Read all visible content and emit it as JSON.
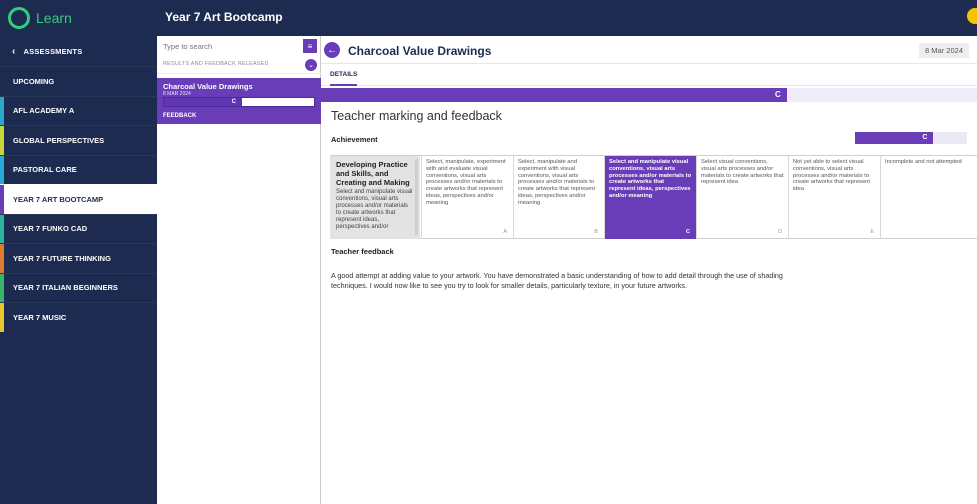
{
  "app": {
    "logo_text": "Learn",
    "title": "Year 7 Art Bootcamp"
  },
  "nav": {
    "back_label": "ASSESSMENTS",
    "items": [
      {
        "label": "UPCOMING",
        "stripe": ""
      },
      {
        "label": "AFL ACADEMY A",
        "stripe": "#2aa8c9"
      },
      {
        "label": "GLOBAL PERSPECTIVES",
        "stripe": "#c7d43a"
      },
      {
        "label": "PASTORAL CARE",
        "stripe": "#29a9d6"
      },
      {
        "label": "YEAR 7 ART BOOTCAMP",
        "stripe": "#6a3db8"
      },
      {
        "label": "YEAR 7 FUNKO CAD",
        "stripe": "#2eb5a2"
      },
      {
        "label": "YEAR 7 FUTURE THINKING",
        "stripe": "#e07a2f"
      },
      {
        "label": "YEAR 7 ITALIAN BEGINNERS",
        "stripe": "#3db26b"
      },
      {
        "label": "YEAR 7 MUSIC",
        "stripe": "#e6c72c"
      }
    ],
    "active_index": 4
  },
  "list": {
    "search_placeholder": "Type to search",
    "filter_label": "RESULTS AND FEEDBACK RELEASED",
    "card": {
      "name": "Charcoal Value Drawings",
      "date": "8 MAR 2024",
      "grade": "C",
      "grade_fraction": 0.52
    },
    "feedback_label": "FEEDBACK"
  },
  "main": {
    "title": "Charcoal Value Drawings",
    "date": "8 Mar 2024",
    "tab": "DETAILS",
    "grade": "C",
    "grade_fraction": 0.71,
    "section_title": "Teacher marking and feedback",
    "achievement_label": "Achievement",
    "achievement_grade": "C",
    "achievement_fraction": 0.7,
    "rubric": {
      "criterion_title": "Developing Practice and Skills, and Creating and Making",
      "criterion_desc": "Select and manipulate visual conventions, visual arts processes and/or materials to create artworks that represent ideas, perspectives and/or",
      "levels": [
        {
          "text": "Select, manipulate, experiment with and evaluate visual conventions, visual arts processes and/or materials to create artworks that represent ideas, perspectives and/or meaning",
          "grade": "A"
        },
        {
          "text": "Select, manipulate and experiment with visual conventions, visual arts processes and/or materials to create artworks that represent ideas, perspectives and/or meaning",
          "grade": "B"
        },
        {
          "text": "Select and manipulate visual conventions, visual arts processes and/or materials to create artworks that represent ideas, perspectives and/or meaning",
          "grade": "C"
        },
        {
          "text": "Select visual conventions, visual arts processes and/or materials to create artworks that represent idea",
          "grade": "D"
        },
        {
          "text": "Not yet able to select visual conventions, visual arts processes and/or materials to create artworks that represent idea",
          "grade": "E"
        },
        {
          "text": "Incomplete and not attempted",
          "grade": ""
        }
      ],
      "selected_index": 2
    },
    "feedback_label": "Teacher feedback",
    "feedback_text": "A good attempt at adding value to your artwork. You have demonstrated a basic understanding of how to add detail through the use of shading techniques. I would now like to see you try to look for smaller details, particularly texture, in your future artworks."
  }
}
